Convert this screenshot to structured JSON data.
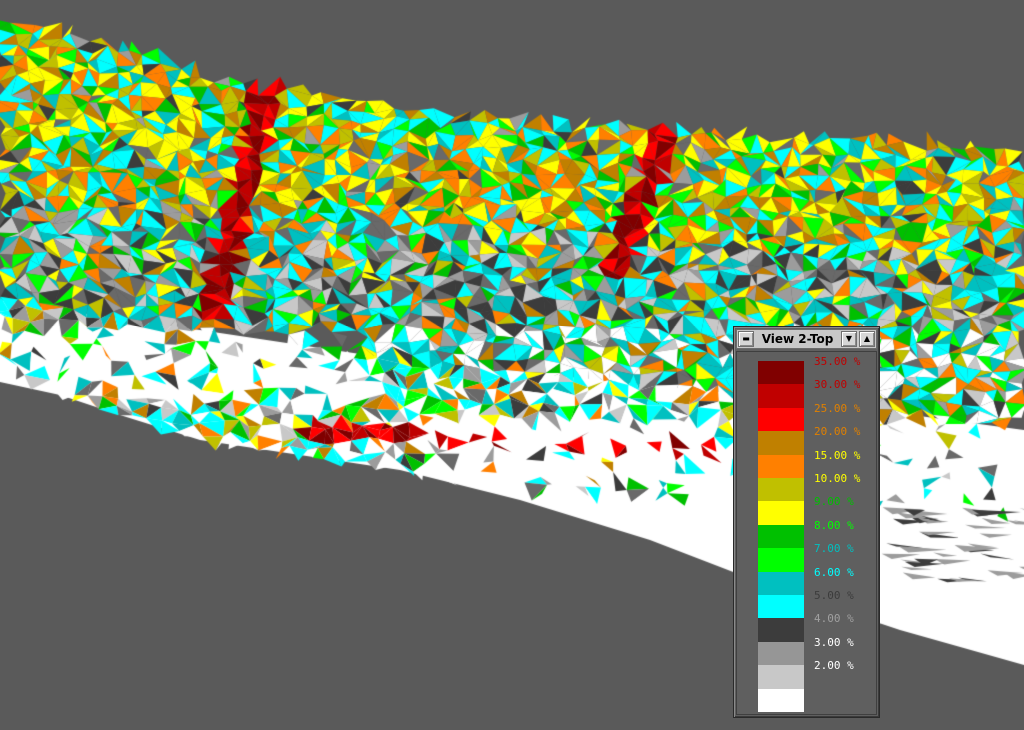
{
  "viewport": {
    "background": "#5a5a5a",
    "surface_palette": [
      "#ffffff",
      "#c8c8c8",
      "#9c9c9c",
      "#3c3c3c",
      "#696969",
      "#00ffff",
      "#00c0c0",
      "#00ff00",
      "#00c000",
      "#ffff00",
      "#c0c000",
      "#ff8000",
      "#c08000",
      "#ff0000",
      "#c00000",
      "#800000"
    ]
  },
  "legend_window": {
    "title": "View 2-Top",
    "buttons": {
      "menu": "menu-icon",
      "collapse": "chevron-down-icon",
      "raise": "chevron-up-icon"
    },
    "entries": [
      {
        "label": "35.00 %",
        "swatch": "#800000",
        "text_color": "#c00000"
      },
      {
        "label": "30.00 %",
        "swatch": "#c00000",
        "text_color": "#c00000"
      },
      {
        "label": "25.00 %",
        "swatch": "#ff0000",
        "text_color": "#e08000"
      },
      {
        "label": "20.00 %",
        "swatch": "#c08000",
        "text_color": "#e08000"
      },
      {
        "label": "15.00 %",
        "swatch": "#ff8000",
        "text_color": "#ffff00"
      },
      {
        "label": "10.00 %",
        "swatch": "#c0c000",
        "text_color": "#ffff00"
      },
      {
        "label": "9.00 %",
        "swatch": "#ffff00",
        "text_color": "#00c000"
      },
      {
        "label": "8.00 %",
        "swatch": "#00c000",
        "text_color": "#00ff00"
      },
      {
        "label": "7.00 %",
        "swatch": "#00ff00",
        "text_color": "#00c0c0"
      },
      {
        "label": "6.00 %",
        "swatch": "#00c0c0",
        "text_color": "#00ffff"
      },
      {
        "label": "5.00 %",
        "swatch": "#00ffff",
        "text_color": "#3c3c3c"
      },
      {
        "label": "4.00 %",
        "swatch": "#3c3c3c",
        "text_color": "#a0a0a0"
      },
      {
        "label": "3.00 %",
        "swatch": "#969696",
        "text_color": "#ffffff"
      },
      {
        "label": "2.00 %",
        "swatch": "#c8c8c8",
        "text_color": "#ffffff"
      },
      {
        "label": "",
        "swatch": "#ffffff",
        "text_color": "#ffffff"
      }
    ]
  }
}
